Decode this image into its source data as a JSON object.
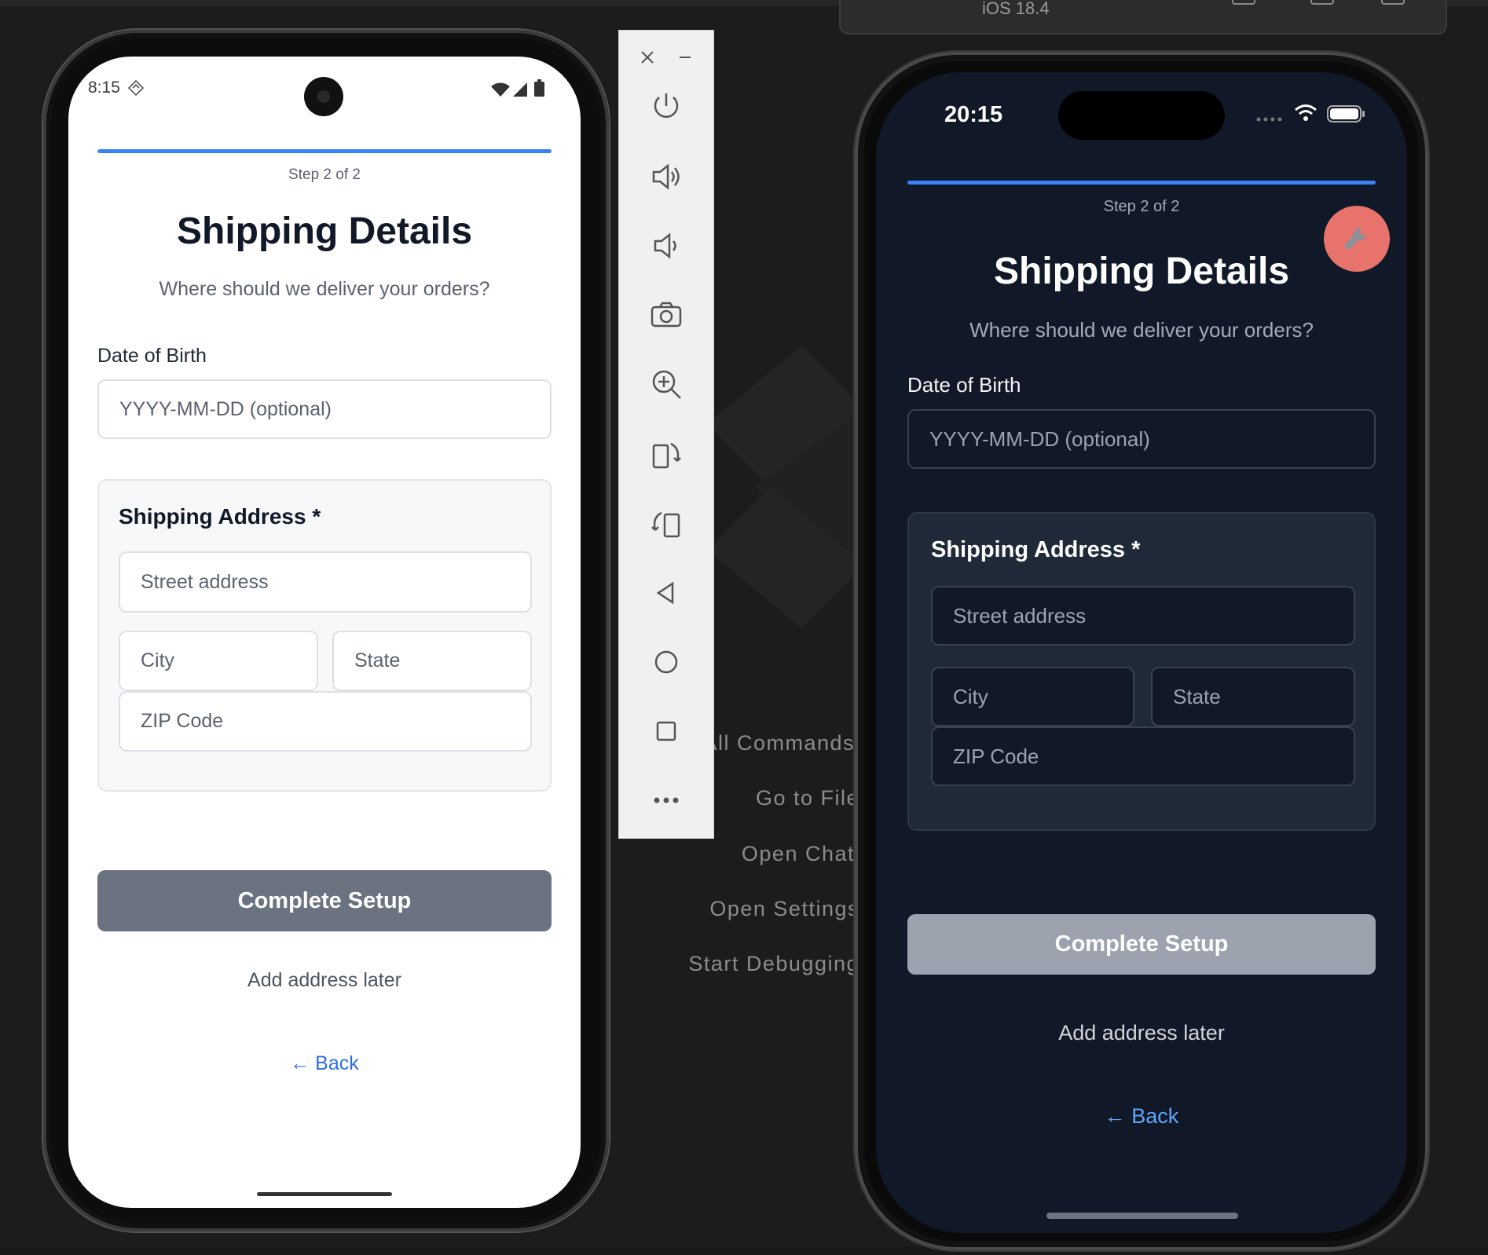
{
  "background": {
    "vscode_commands": [
      "All Commands",
      "Go to File",
      "Open Chat",
      "Open Settings",
      "Start Debugging"
    ]
  },
  "ios_simulator": {
    "title_bar_label": "iOS 18.4"
  },
  "android_phone": {
    "status": {
      "time": "8:15"
    },
    "screen": {
      "step_label": "Step 2 of 2",
      "title": "Shipping Details",
      "subtitle": "Where should we deliver your orders?",
      "dob_label": "Date of Birth",
      "dob_placeholder": "YYYY-MM-DD (optional)",
      "address_section_label": "Shipping Address *",
      "street_placeholder": "Street address",
      "city_placeholder": "City",
      "state_placeholder": "State",
      "zip_placeholder": "ZIP Code",
      "complete_button": "Complete Setup",
      "skip_link": "Add address later",
      "back_link": "← Back"
    }
  },
  "ios_phone": {
    "status": {
      "time": "20:15"
    },
    "screen": {
      "step_label": "Step 2 of 2",
      "title": "Shipping Details",
      "subtitle": "Where should we deliver your orders?",
      "dob_label": "Date of Birth",
      "dob_placeholder": "YYYY-MM-DD (optional)",
      "address_section_label": "Shipping Address *",
      "street_placeholder": "Street address",
      "city_placeholder": "City",
      "state_placeholder": "State",
      "zip_placeholder": "ZIP Code",
      "complete_button": "Complete Setup",
      "skip_link": "Add address later",
      "back_link": "← Back",
      "dev_tools_icon": "wrench-icon"
    }
  },
  "colors": {
    "progress_blue": "#3b82f6",
    "link_blue": "#2f6fe0",
    "android_button": "#6b7280",
    "ios_button": "#9ca3af",
    "ios_bg": "#111827",
    "dev_button": "#e8736c"
  },
  "emulator_toolbar": {
    "icons": [
      "close-icon",
      "minimize-icon",
      "power-icon",
      "volume-up-icon",
      "volume-down-icon",
      "camera-icon",
      "zoom-icon",
      "rotate-left-icon",
      "rotate-right-icon",
      "back-nav-icon",
      "home-nav-icon",
      "overview-nav-icon",
      "more-icon"
    ]
  }
}
